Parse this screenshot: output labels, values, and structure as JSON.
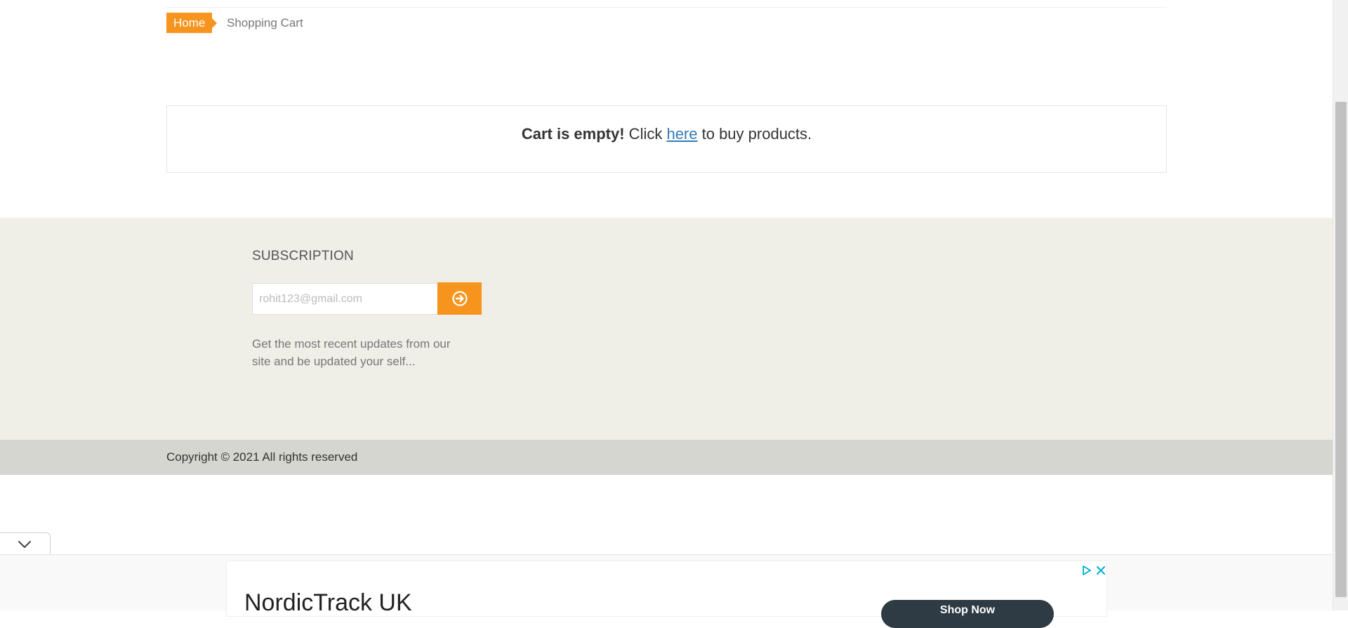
{
  "breadcrumb": {
    "home_label": "Home",
    "current_label": "Shopping Cart"
  },
  "cart": {
    "empty_bold": "Cart is empty!",
    "text_before_link": " Click ",
    "link_label": "here",
    "text_after_link": " to buy products."
  },
  "subscription": {
    "title": "SUBSCRIPTION",
    "email_value": "rohit123@gmail.com",
    "submit_icon": "arrow-circle-right-icon",
    "description": "Get the most recent updates from our site and be updated your self..."
  },
  "footer": {
    "copyright": "Copyright © 2021 All rights reserved"
  },
  "ad": {
    "collapse_icon": "chevron-down-icon",
    "title": "NordicTrack UK",
    "cta_label": "Shop Now",
    "info_icon": "adchoices-icon",
    "close_icon": "close-icon"
  },
  "colors": {
    "accent": "#f7941d",
    "link": "#337ab7",
    "subscribe_bg": "#efeee7",
    "copyright_bg": "#d6d6d0"
  }
}
